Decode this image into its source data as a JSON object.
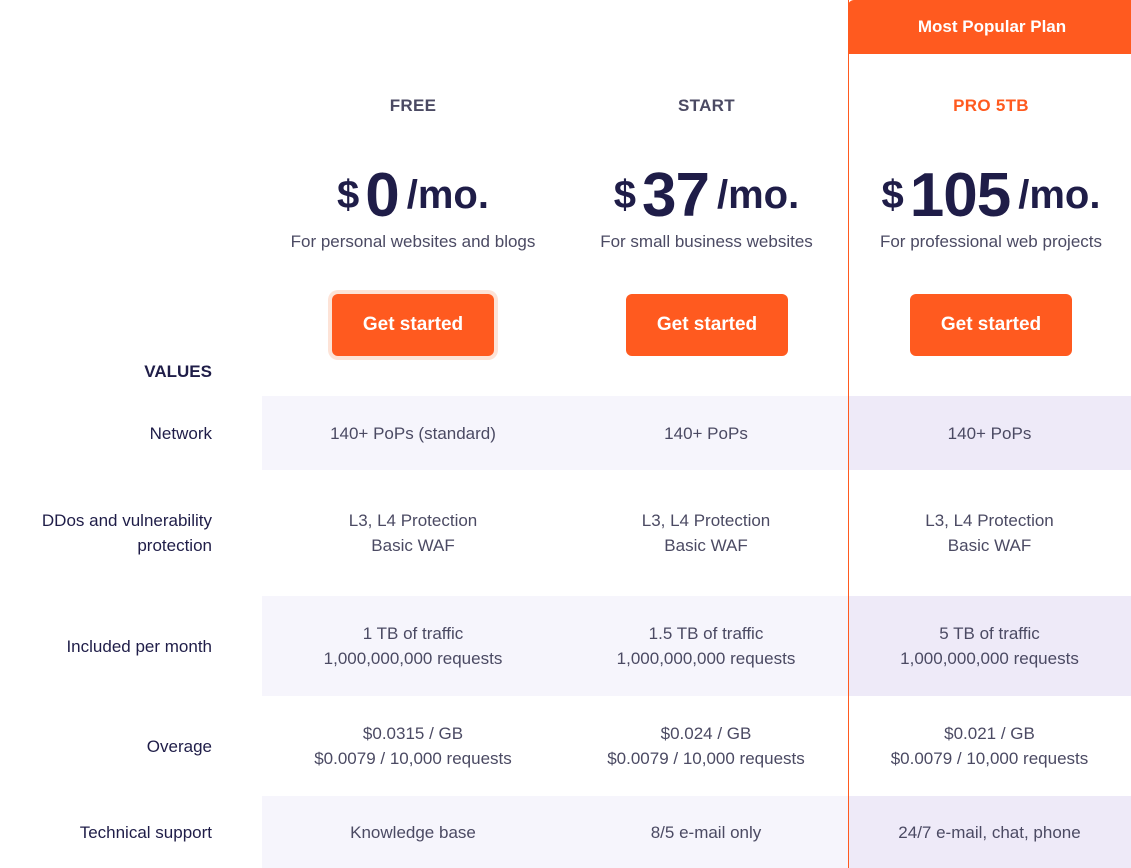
{
  "banner": {
    "label": "Most Popular Plan"
  },
  "plans": [
    {
      "name": "FREE",
      "currency": "$",
      "amount": "0",
      "period": "/mo.",
      "description": "For personal websites and blogs",
      "cta": "Get started"
    },
    {
      "name": "START",
      "currency": "$",
      "amount": "37",
      "period": "/mo.",
      "description": "For small business websites",
      "cta": "Get started"
    },
    {
      "name": "PRO 5TB",
      "currency": "$",
      "amount": "105",
      "period": "/mo.",
      "description": "For professional web projects",
      "cta": "Get started"
    }
  ],
  "values_heading": "VALUES",
  "rows": [
    {
      "label": "Network",
      "cells": [
        [
          "140+ PoPs (standard)"
        ],
        [
          "140+ PoPs"
        ],
        [
          "140+ PoPs"
        ]
      ]
    },
    {
      "label": "DDos and vulnerability protection",
      "cells": [
        [
          "L3, L4 Protection",
          "Basic WAF"
        ],
        [
          "L3, L4 Protection",
          "Basic WAF"
        ],
        [
          "L3, L4 Protection",
          "Basic WAF"
        ]
      ]
    },
    {
      "label": "Included per month",
      "cells": [
        [
          "1 TB of traffic",
          "1,000,000,000 requests"
        ],
        [
          "1.5 TB of traffic",
          "1,000,000,000 requests"
        ],
        [
          "5 TB of traffic",
          "1,000,000,000 requests"
        ]
      ]
    },
    {
      "label": "Overage",
      "cells": [
        [
          "$0.0315 / GB",
          "$0.0079 / 10,000 requests"
        ],
        [
          "$0.024 / GB",
          "$0.0079 / 10,000 requests"
        ],
        [
          "$0.021 / GB",
          "$0.0079 / 10,000 requests"
        ]
      ]
    },
    {
      "label": "Technical support",
      "cells": [
        [
          "Knowledge base"
        ],
        [
          "8/5 e-mail only"
        ],
        [
          "24/7 e-mail, chat, phone"
        ]
      ]
    }
  ],
  "colors": {
    "accent": "#ff5a1f",
    "text_dark": "#1f1d48",
    "text_muted": "#4b4a63",
    "row_shade": "#f6f5fc",
    "row_shade_pro": "#eeeaf8"
  }
}
